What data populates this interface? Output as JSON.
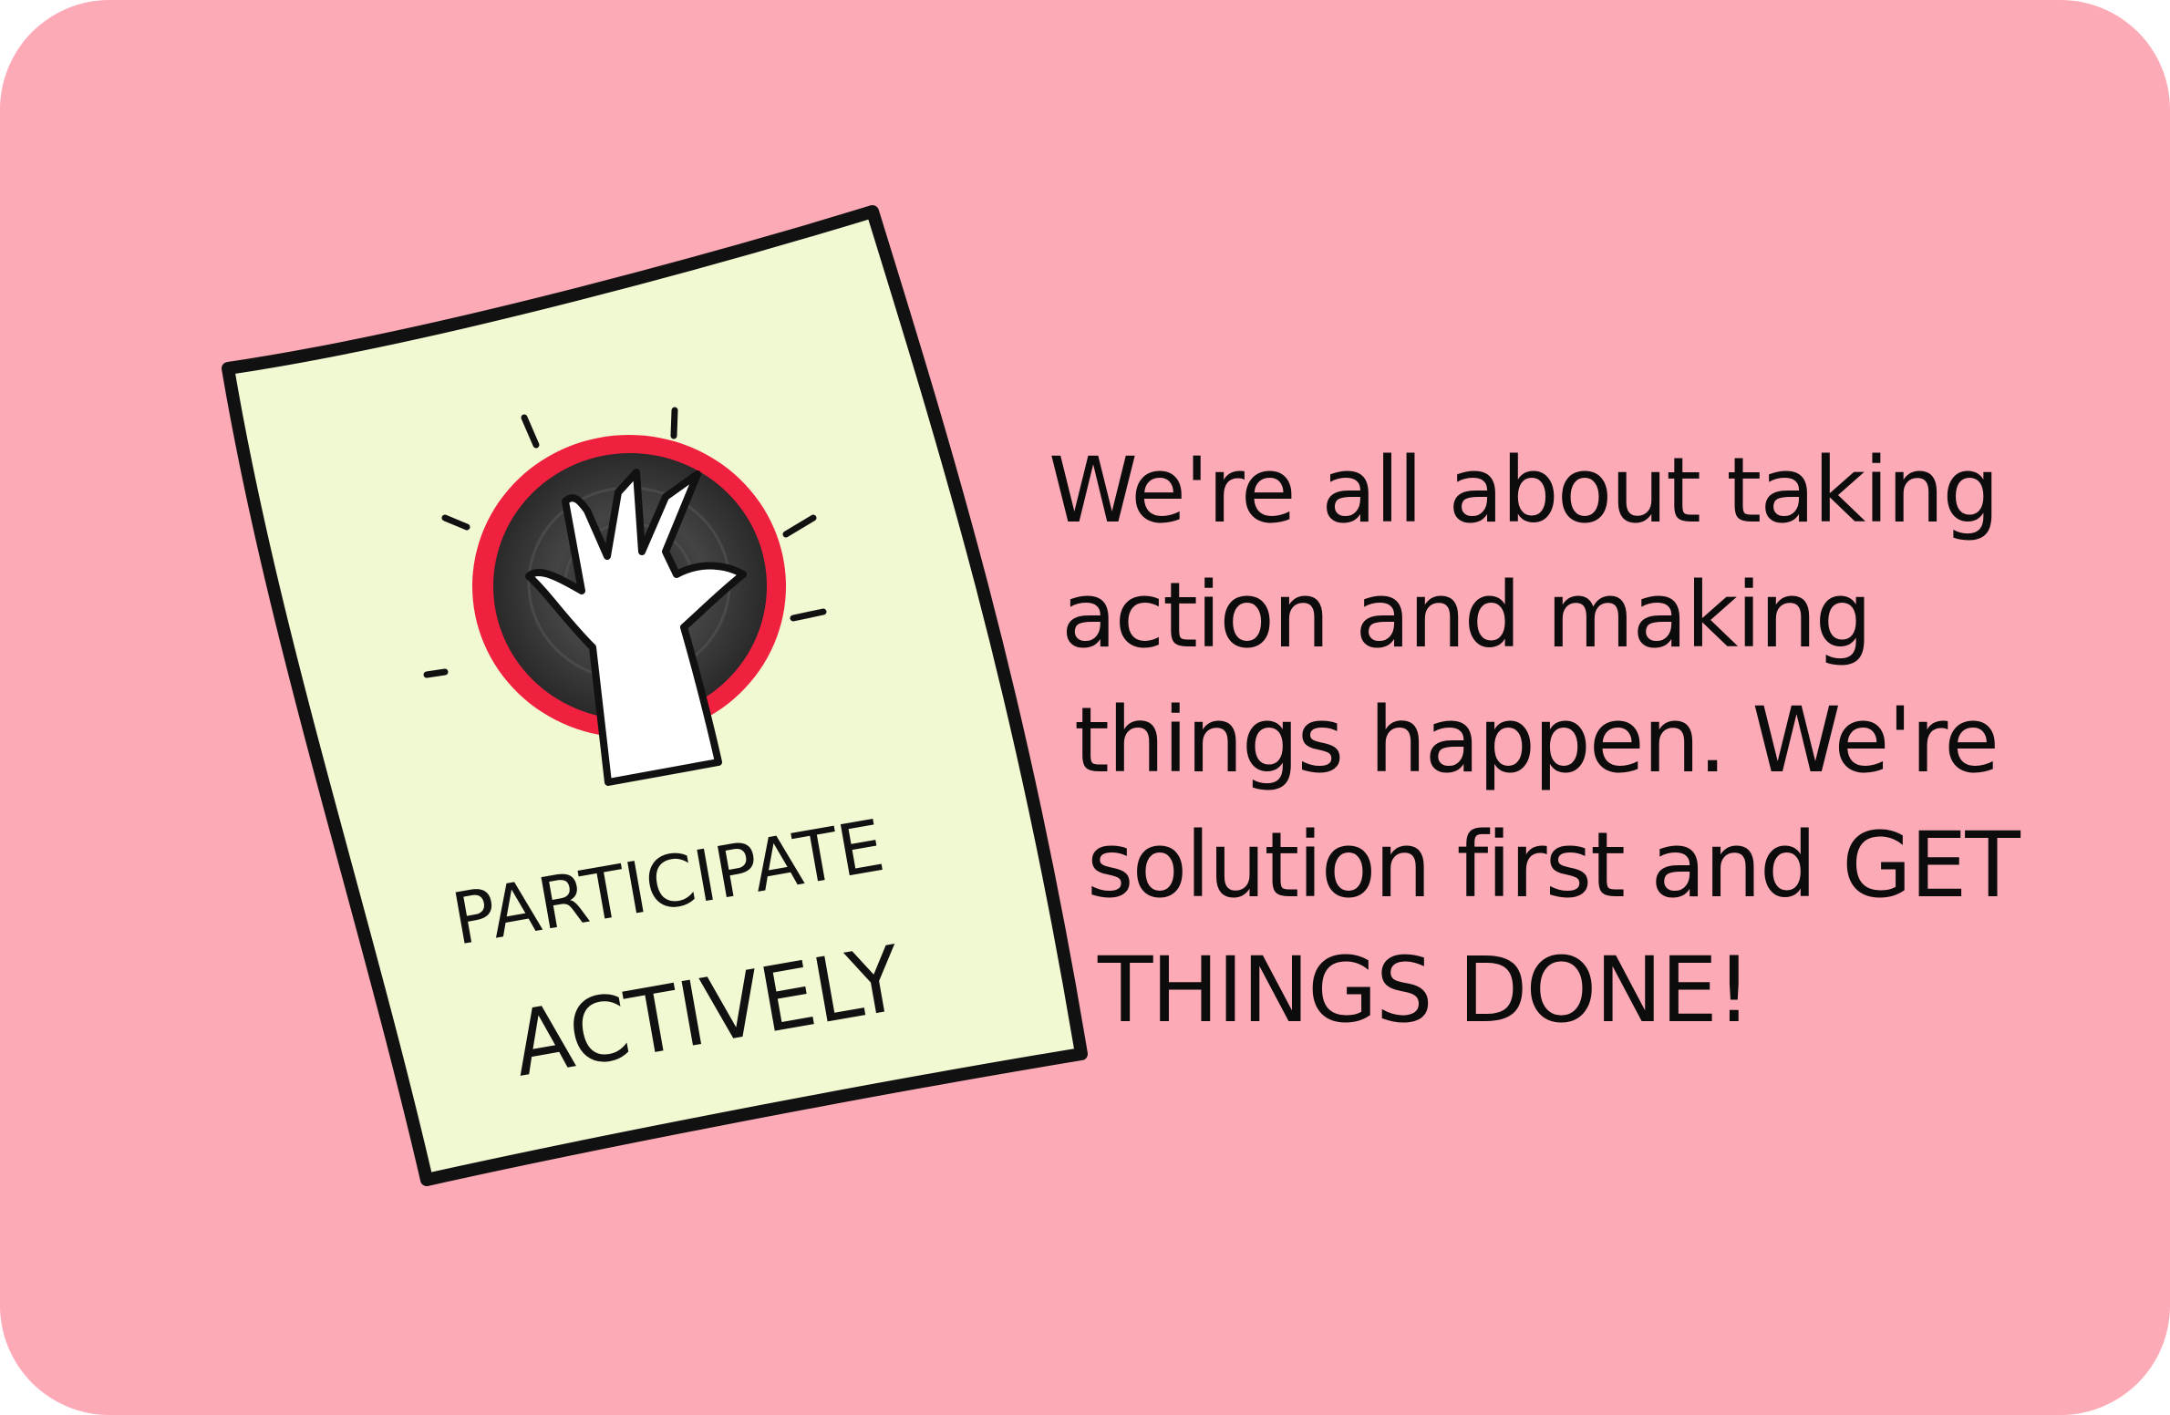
{
  "colors": {
    "card_background": "#fdaab7",
    "poster_paper": "#f1f9d3",
    "outline": "#111111",
    "accent_ring": "#f0213f",
    "circle_fill": "#3d3d3d",
    "text": "#0c0c0c"
  },
  "poster": {
    "icon": "raised-hand-icon",
    "title_line_1": "PARTICIPATE",
    "title_line_2": "ACTIVELY"
  },
  "message": {
    "lines": [
      "We're all about taking",
      "action and making",
      "things happen. We're",
      "solution first and GET",
      "THINGS DONE!"
    ]
  }
}
